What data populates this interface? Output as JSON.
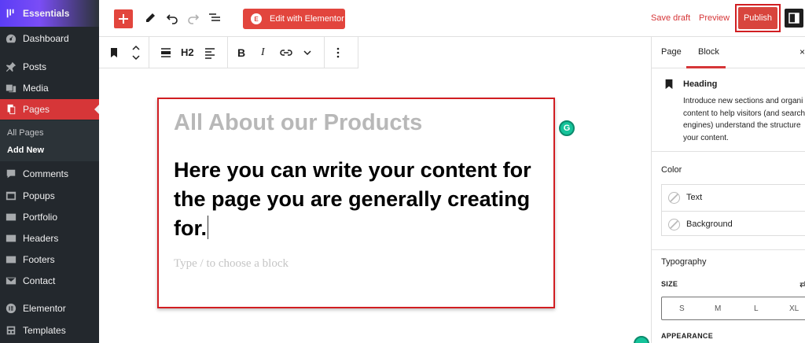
{
  "colors": {
    "accent": "#d63638",
    "elementor": "#e2453d",
    "sidebar_bg": "#23282d"
  },
  "admin_menu": {
    "brand": "Essentials",
    "items": [
      {
        "label": "Dashboard",
        "icon": "dashboard-icon"
      },
      {
        "label": "Posts",
        "icon": "pin-icon"
      },
      {
        "label": "Media",
        "icon": "media-icon"
      },
      {
        "label": "Pages",
        "icon": "pages-icon",
        "active": true
      },
      {
        "label": "Comments",
        "icon": "comment-icon"
      },
      {
        "label": "Popups",
        "icon": "popup-icon"
      },
      {
        "label": "Portfolio",
        "icon": "portfolio-icon"
      },
      {
        "label": "Headers",
        "icon": "header-icon"
      },
      {
        "label": "Footers",
        "icon": "footer-icon"
      },
      {
        "label": "Contact",
        "icon": "mail-icon"
      },
      {
        "label": "Elementor",
        "icon": "elementor-icon"
      },
      {
        "label": "Templates",
        "icon": "templates-icon"
      }
    ],
    "submenu": [
      {
        "label": "All Pages"
      },
      {
        "label": "Add New",
        "current": true
      }
    ]
  },
  "topbar": {
    "add_icon": "plus-icon",
    "edit_with_elementor": "Edit with Elementor",
    "save_draft": "Save draft",
    "preview": "Preview",
    "publish": "Publish"
  },
  "block_toolbar": {
    "heading_level": "H2",
    "bold": "B",
    "italic": "I"
  },
  "editor": {
    "title": "All About our  Products",
    "heading": "Here you can write your content for the page you are generally creating for.",
    "placeholder": "Type / to choose a block",
    "grammarly": "G"
  },
  "settings_panel": {
    "tabs": [
      "Page",
      "Block"
    ],
    "active_tab": "Block",
    "close": "×",
    "block_name": "Heading",
    "block_description": [
      "Introduce new sections and organi",
      "content to help visitors (and search",
      "engines) understand the structure",
      "your content."
    ],
    "color_title": "Color",
    "color_options": [
      "Text",
      "Background"
    ],
    "typography_title": "Typography",
    "size_label": "SIZE",
    "size_reset": "⇄",
    "size_options": [
      "S",
      "M",
      "L",
      "XL"
    ],
    "appearance_label": "APPEARANCE"
  }
}
